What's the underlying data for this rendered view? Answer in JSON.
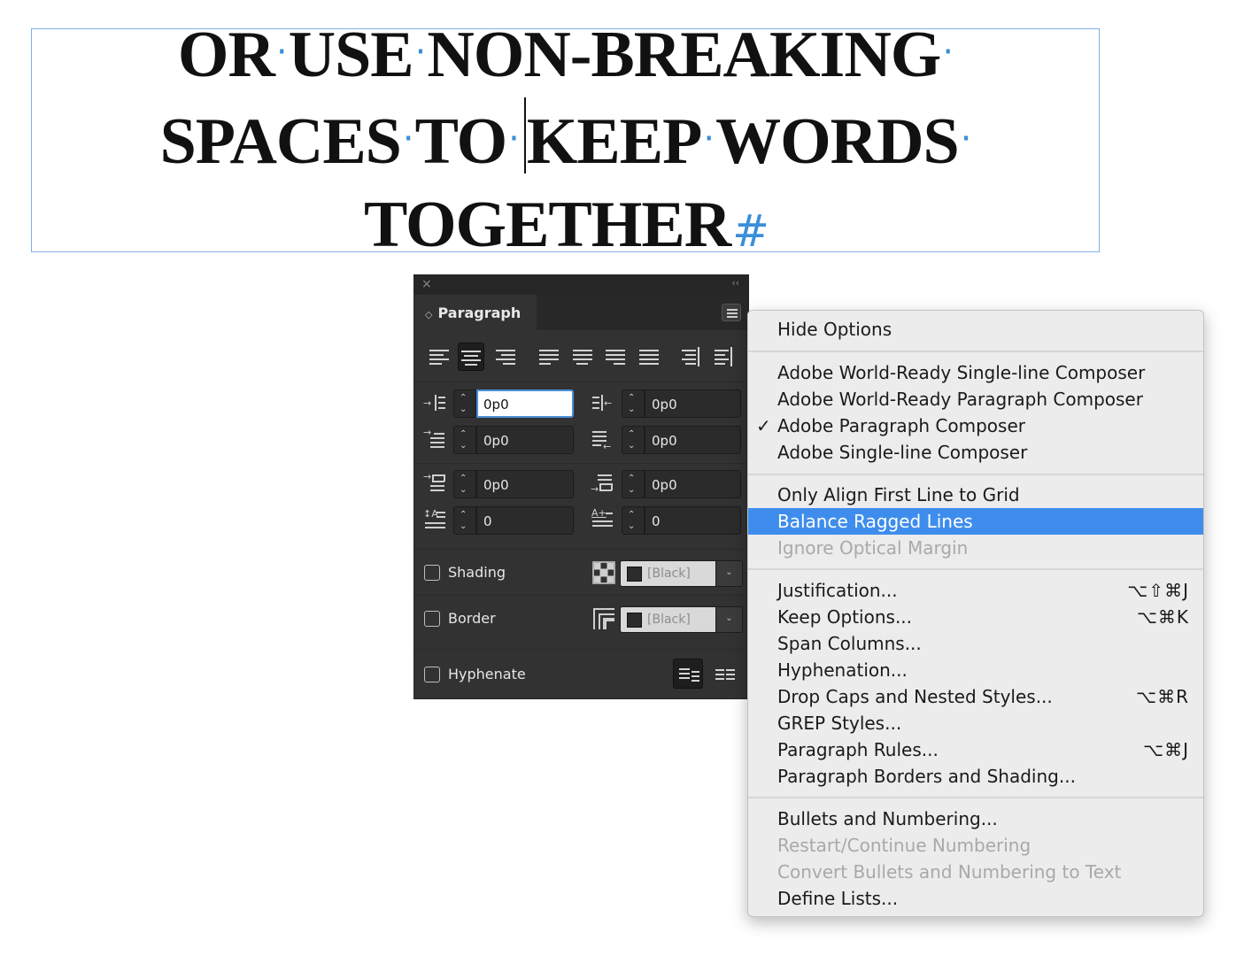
{
  "document": {
    "line1_words": [
      "OR",
      "USE",
      "NON-BREAKING"
    ],
    "line2_words": [
      "SPACES",
      "TO",
      "KEEP",
      "WORDS"
    ],
    "line3_word": "TOGETHER",
    "space_marker": "·",
    "paragraph_marker": "#"
  },
  "panel": {
    "title": "Paragraph",
    "fields": {
      "left_indent": "0p0",
      "right_indent": "0p0",
      "first_line_indent": "0p0",
      "last_line_indent": "0p0",
      "space_before": "0p0",
      "space_after": "0p0",
      "drop_cap_lines": "0",
      "drop_cap_chars": "0"
    },
    "shading": {
      "label": "Shading",
      "checked": false,
      "swatch": "[Black]"
    },
    "border": {
      "label": "Border",
      "checked": false,
      "swatch": "[Black]"
    },
    "hyphenate": {
      "label": "Hyphenate",
      "checked": false
    },
    "icons": {
      "close": "×",
      "collapse": "‹‹",
      "tab_chevron": "⌃⌄",
      "spin_up": "⌃",
      "spin_down": "⌄",
      "dropdown": "⌄"
    },
    "drop_cap_glyphs": {
      "lines": "↕A",
      "chars": "A+"
    },
    "colors": {
      "background": "#323232",
      "focus": "#4b8fd9"
    }
  },
  "menu": {
    "groups": [
      [
        {
          "label": "Hide Options",
          "state": "normal"
        }
      ],
      [
        {
          "label": "Adobe World-Ready Single-line Composer",
          "state": "normal"
        },
        {
          "label": "Adobe World-Ready Paragraph Composer",
          "state": "normal"
        },
        {
          "label": "Adobe Paragraph Composer",
          "state": "checked"
        },
        {
          "label": "Adobe Single-line Composer",
          "state": "normal"
        }
      ],
      [
        {
          "label": "Only Align First Line to Grid",
          "state": "normal"
        },
        {
          "label": "Balance Ragged Lines",
          "state": "highlighted"
        },
        {
          "label": "Ignore Optical Margin",
          "state": "disabled"
        }
      ],
      [
        {
          "label": "Justification...",
          "state": "normal",
          "shortcut": "⌥⇧⌘J"
        },
        {
          "label": "Keep Options...",
          "state": "normal",
          "shortcut": "⌥⌘K"
        },
        {
          "label": "Span Columns...",
          "state": "normal"
        },
        {
          "label": "Hyphenation...",
          "state": "normal"
        },
        {
          "label": "Drop Caps and Nested Styles...",
          "state": "normal",
          "shortcut": "⌥⌘R"
        },
        {
          "label": "GREP Styles...",
          "state": "normal"
        },
        {
          "label": "Paragraph Rules...",
          "state": "normal",
          "shortcut": "⌥⌘J"
        },
        {
          "label": "Paragraph Borders and Shading...",
          "state": "normal"
        }
      ],
      [
        {
          "label": "Bullets and Numbering...",
          "state": "normal"
        },
        {
          "label": "Restart/Continue Numbering",
          "state": "disabled"
        },
        {
          "label": "Convert Bullets and Numbering to Text",
          "state": "disabled"
        },
        {
          "label": "Define Lists...",
          "state": "normal"
        }
      ]
    ],
    "check_glyph": "✓",
    "highlight_color": "#3e8ded"
  }
}
